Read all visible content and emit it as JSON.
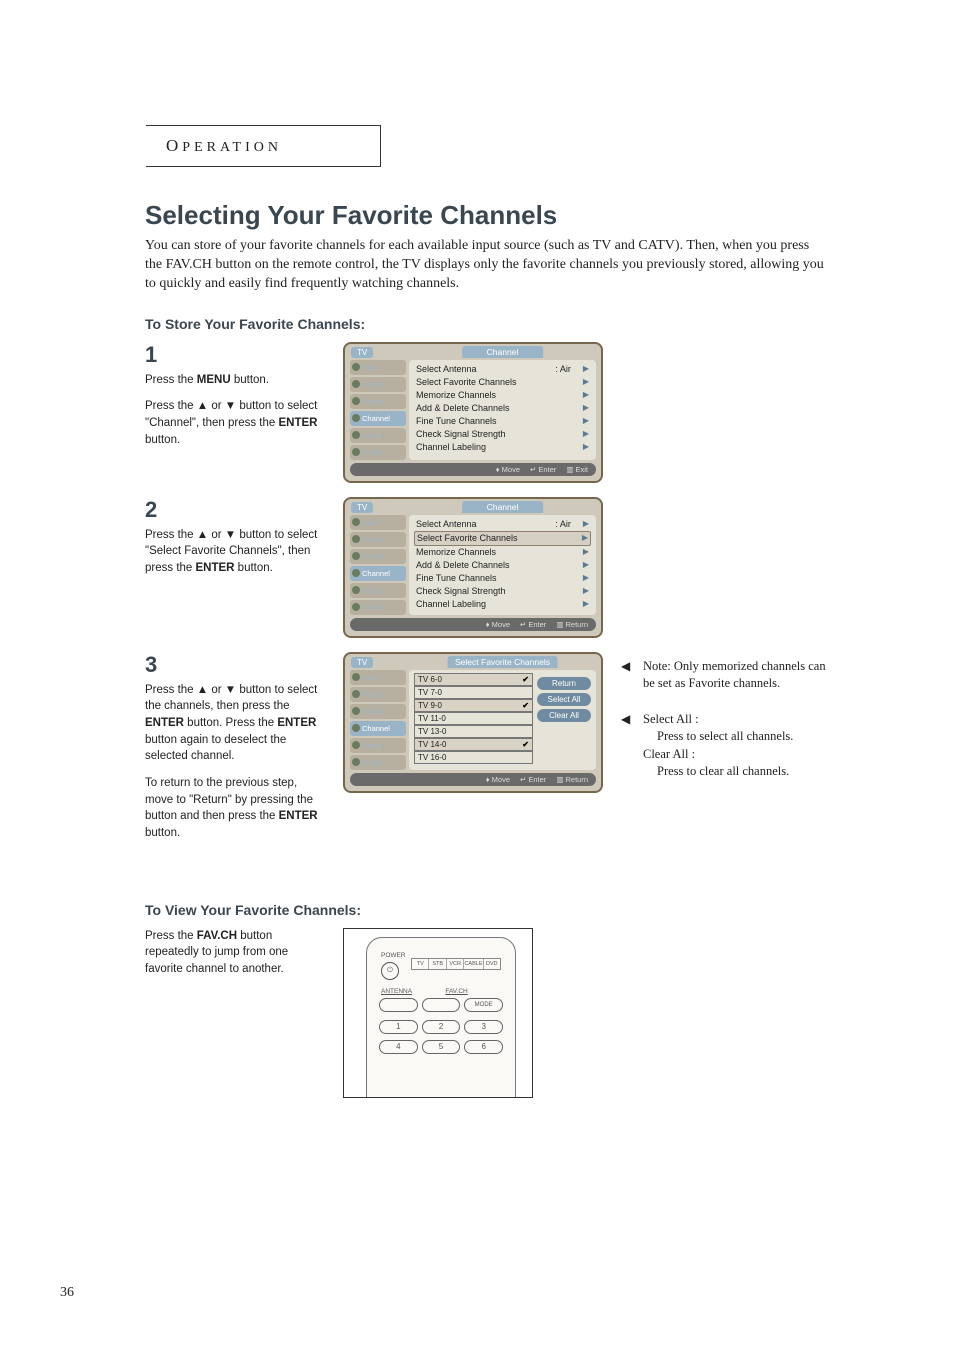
{
  "section_label": {
    "first": "O",
    "rest": "PERATION"
  },
  "title": "Selecting Your Favorite Channels",
  "intro": "You can store of your favorite channels for each available input source (such as TV and CATV). Then, when you press the FAV.CH button on the remote control, the TV displays only the favorite channels you previously stored, allowing you to quickly and easily find frequently watching channels.",
  "subhead_store": "To Store Your Favorite Channels:",
  "subhead_view": "To View Your Favorite Channels:",
  "steps": {
    "s1": {
      "num": "1",
      "p1a": "Press the ",
      "p1b": "MENU",
      "p1c": " button.",
      "p2a": "Press the ▲ or ▼ button to select \"Channel\", then press the ",
      "p2b": "ENTER",
      "p2c": " button."
    },
    "s2": {
      "num": "2",
      "p1a": "Press the ▲ or ▼ button to select \"Select Favorite Channels\", then press the ",
      "p1b": "ENTER",
      "p1c": " button."
    },
    "s3": {
      "num": "3",
      "p1a": "Press the ▲ or ▼ button to select the channels, then press the ",
      "p1b": "ENTER",
      "p1c": " button. Press the ",
      "p1d": "ENTER",
      "p1e": " button again to deselect the selected channel.",
      "p2a": "To return to the previous step, move to \"Return\" by pressing the button and then press the ",
      "p2b": "ENTER",
      "p2c": " button."
    }
  },
  "osd": {
    "tv_label": "TV",
    "channel_header": "Channel",
    "fav_header": "Select Favorite Channels",
    "side": [
      "Input",
      "Picture",
      "Sound",
      "Channel",
      "Setup",
      "Guide"
    ],
    "side_active_index": 3,
    "items": [
      {
        "label": "Select Antenna",
        "value": ": Air"
      },
      {
        "label": "Select Favorite Channels",
        "value": ""
      },
      {
        "label": "Memorize Channels",
        "value": ""
      },
      {
        "label": "Add & Delete Channels",
        "value": ""
      },
      {
        "label": "Fine Tune Channels",
        "value": ""
      },
      {
        "label": "Check Signal Strength",
        "value": ""
      },
      {
        "label": "Channel Labeling",
        "value": ""
      }
    ],
    "fav_list": [
      {
        "label": "TV 6-0",
        "checked": true
      },
      {
        "label": "TV 7-0",
        "checked": false
      },
      {
        "label": "TV 9-0",
        "checked": true
      },
      {
        "label": "TV 11-0",
        "checked": false
      },
      {
        "label": "TV 13-0",
        "checked": false
      },
      {
        "label": "TV 14-0",
        "checked": true
      },
      {
        "label": "TV 16-0",
        "checked": false
      }
    ],
    "fav_buttons": {
      "return": "Return",
      "select_all": "Select All",
      "clear_all": "Clear All"
    },
    "footer": {
      "move": "Move",
      "enter": "Enter",
      "exit": "Exit",
      "return": "Return"
    }
  },
  "notes": {
    "n1": "Note: Only memorized channels can be set as Favorite channels.",
    "n2_title": "Select All :",
    "n2_body": "Press to select all channels.",
    "n3_title": "Clear All :",
    "n3_body": "Press to clear all channels."
  },
  "view_step": {
    "p1a": "Press the ",
    "p1b": "FAV.CH",
    "p1c": " button repeatedly to jump from one favorite channel to another."
  },
  "remote": {
    "power": "POWER",
    "modes": [
      "TV",
      "STB",
      "VCR",
      "CABLE",
      "DVD"
    ],
    "labels": {
      "antenna": "ANTENNA",
      "favch": "FAV.CH",
      "mode": "MODE"
    },
    "nums_row1": [
      "1",
      "2",
      "3"
    ],
    "nums_row2": [
      "4",
      "5",
      "6"
    ]
  },
  "page_number": "36"
}
